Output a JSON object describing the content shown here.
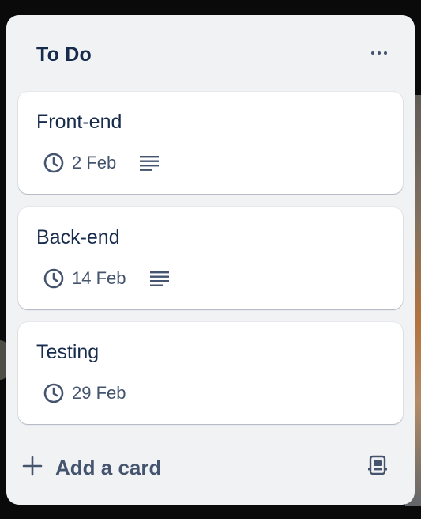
{
  "list": {
    "title": "To Do",
    "cards": [
      {
        "title": "Front-end",
        "due": "2 Feb",
        "has_description": true
      },
      {
        "title": "Back-end",
        "due": "14 Feb",
        "has_description": true
      },
      {
        "title": "Testing",
        "due": "29 Feb",
        "has_description": false
      }
    ],
    "add_card_label": "Add a card"
  },
  "icons": {
    "menu": "more-horizontal-icon",
    "due": "clock-icon",
    "description": "description-lines-icon",
    "add": "plus-icon",
    "template": "card-template-icon"
  },
  "colors": {
    "list_bg": "#f1f2f4",
    "card_bg": "#ffffff",
    "title_text": "#172b4d",
    "secondary_text": "#44546f"
  }
}
